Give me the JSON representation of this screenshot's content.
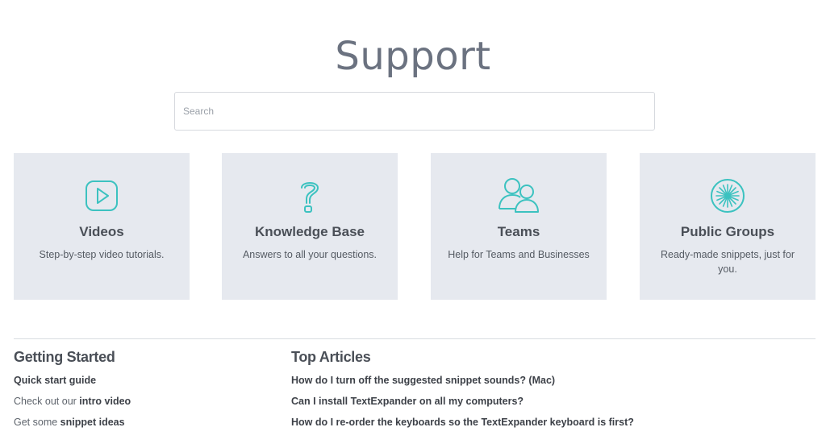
{
  "header": {
    "title": "Support"
  },
  "search": {
    "placeholder": "Search"
  },
  "colors": {
    "card_bg": "#e6e9ef",
    "icon_accent": "#3cc2c0",
    "text_dark": "#4a4f57"
  },
  "cards": [
    {
      "icon": "video-play-icon",
      "title": "Videos",
      "description": "Step-by-step video tutorials."
    },
    {
      "icon": "question-mark-icon",
      "title": "Knowledge Base",
      "description": "Answers to all your questions."
    },
    {
      "icon": "people-icon",
      "title": "Teams",
      "description": "Help for Teams and Businesses"
    },
    {
      "icon": "starburst-icon",
      "title": "Public Groups",
      "description": "Ready-made snippets, just for you."
    }
  ],
  "getting_started": {
    "heading": "Getting Started",
    "items": [
      {
        "prefix": "",
        "link": "Quick start guide"
      },
      {
        "prefix": "Check out our ",
        "link": "intro video"
      },
      {
        "prefix": "Get some ",
        "link": "snippet ideas"
      }
    ]
  },
  "top_articles": {
    "heading": "Top Articles",
    "items": [
      "How do I turn off the suggested snippet sounds? (Mac)",
      "Can I install TextExpander on all my computers?",
      "How do I re-order the keyboards so the TextExpander keyboard is first?"
    ]
  }
}
